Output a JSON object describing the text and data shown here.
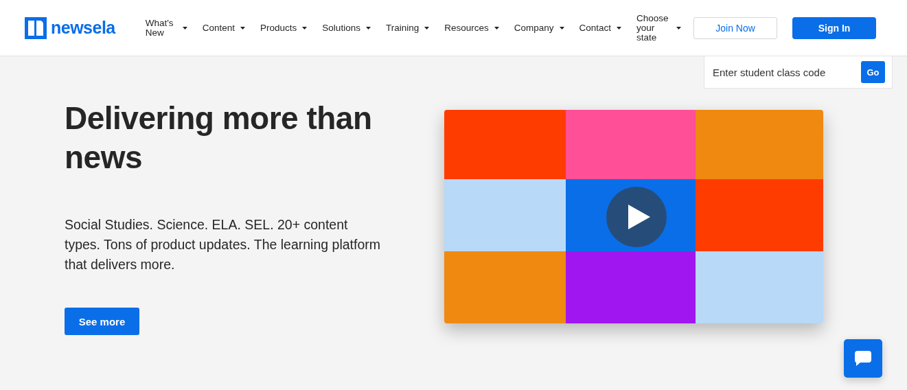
{
  "header": {
    "logo": "newsela",
    "nav": [
      {
        "label": "What's New"
      },
      {
        "label": "Content"
      },
      {
        "label": "Products"
      },
      {
        "label": "Solutions"
      },
      {
        "label": "Training"
      },
      {
        "label": "Resources"
      },
      {
        "label": "Company"
      },
      {
        "label": "Contact"
      },
      {
        "label": "Choose your state"
      }
    ],
    "join_button": "Join Now",
    "sign_in_button": "Sign In"
  },
  "class_code": {
    "placeholder": "Enter student class code",
    "button": "Go"
  },
  "hero": {
    "heading": "Delivering more than news",
    "text": "Social Studies. Science. ELA. SEL. 20+ content types. Tons of product updates. The learning platform that delivers more.",
    "button": "See more"
  }
}
